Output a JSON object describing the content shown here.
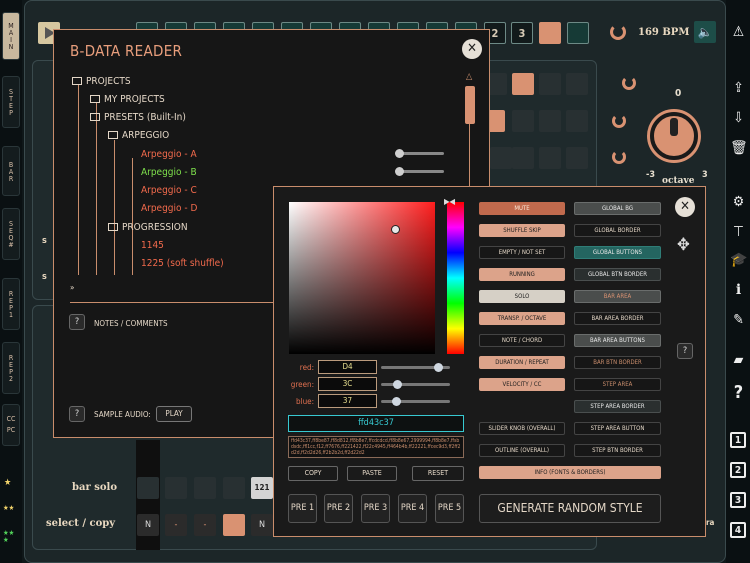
{
  "left_tabs": [
    {
      "label": "MAIN"
    },
    {
      "label": "STEP"
    },
    {
      "label": "BAR"
    },
    {
      "label": "SEQ#"
    },
    {
      "label": "REP1"
    },
    {
      "label": "REP2"
    },
    {
      "label": "CC PC"
    }
  ],
  "top": {
    "nums": [
      "2",
      "3"
    ],
    "bpm": "169 BPM"
  },
  "knob": {
    "value": "0",
    "min": "-3",
    "max": "3",
    "label": "octave"
  },
  "grid_labels": {
    "bar_solo": "bar solo",
    "select_copy": "select / copy",
    "bar_mute": "bar mute",
    "cell_n": "N",
    "cell_dash": "-",
    "cell_121": "121",
    "trailing": "ra",
    "left_s1": "s",
    "left_s2": "s"
  },
  "reader": {
    "title": "B-DATA READER",
    "tree": {
      "projects": "PROJECTS",
      "my_projects": "MY PROJECTS",
      "presets": "PRESETS (Built-In)",
      "arpeggio": "ARPEGGIO",
      "arp_a": "Arpeggio - A",
      "arp_b": "Arpeggio - B",
      "arp_c": "Arpeggio - C",
      "arp_d": "Arpeggio - D",
      "progression": "PROGRESSION",
      "p1145": "1145",
      "p1225": "1225 (soft shuffle)"
    },
    "more": "»",
    "notes": "NOTES / COMMENTS",
    "sample_audio": "SAMPLE AUDIO:",
    "play": "PLAY",
    "help": "?"
  },
  "picker": {
    "red_label": "red:",
    "green_label": "green:",
    "blue_label": "blue:",
    "red": "D4",
    "green": "3C",
    "blue": "37",
    "red_level": 0.83,
    "green_level": 0.24,
    "blue_level": 0.22,
    "hex": "ffd43c37",
    "style_text": "ffd43c37,ff8be87,ff8d812,ff8b8e7,ffcdcdcd,ff8b8e67,2999994,ff8b8e7,ffsbdsdc,ffl1cc,f12,ff7676,ff221422,ff22c4945,ff464b4b,ff22221,ffcec9d3,ff2ff2d2d,ff2d2d26,ff2b2b2d,ff2d22d2",
    "copy": "COPY",
    "paste": "PASTE",
    "reset": "RESET",
    "presets": [
      "PRE 1",
      "PRE 2",
      "PRE 3",
      "PRE 4",
      "PRE 5"
    ],
    "generate": "GENERATE RANDOM STYLE",
    "help": "?",
    "col1": [
      "MUTE",
      "SHUFFLE SKIP",
      "EMPTY / NOT SET",
      "RUNNING",
      "SOLO",
      "TRANSP. / OCTAVE",
      "NOTE / CHORD",
      "DURATION / REPEAT",
      "VELOCITY / CC",
      "SLIDER KNOB (OVERALL)",
      "OUTLINE (OVERALL)",
      "INFO (FONTS & BORDERS)"
    ],
    "col2": [
      "GLOBAL BG",
      "GLOBAL BORDER",
      "GLOBAL BUTTONS",
      "GLOBAL BTN BORDER",
      "BAR AREA",
      "BAR AREA BORDER",
      "BAR AREA BUTTONS",
      "BAR BTN BORDER",
      "STEP AREA",
      "STEP AREA BORDER",
      "STEP AREA BUTTON",
      "STEP BTN BORDER"
    ]
  },
  "colors": {
    "accent": "#c98d6c",
    "selected_color": "#d43c37"
  }
}
